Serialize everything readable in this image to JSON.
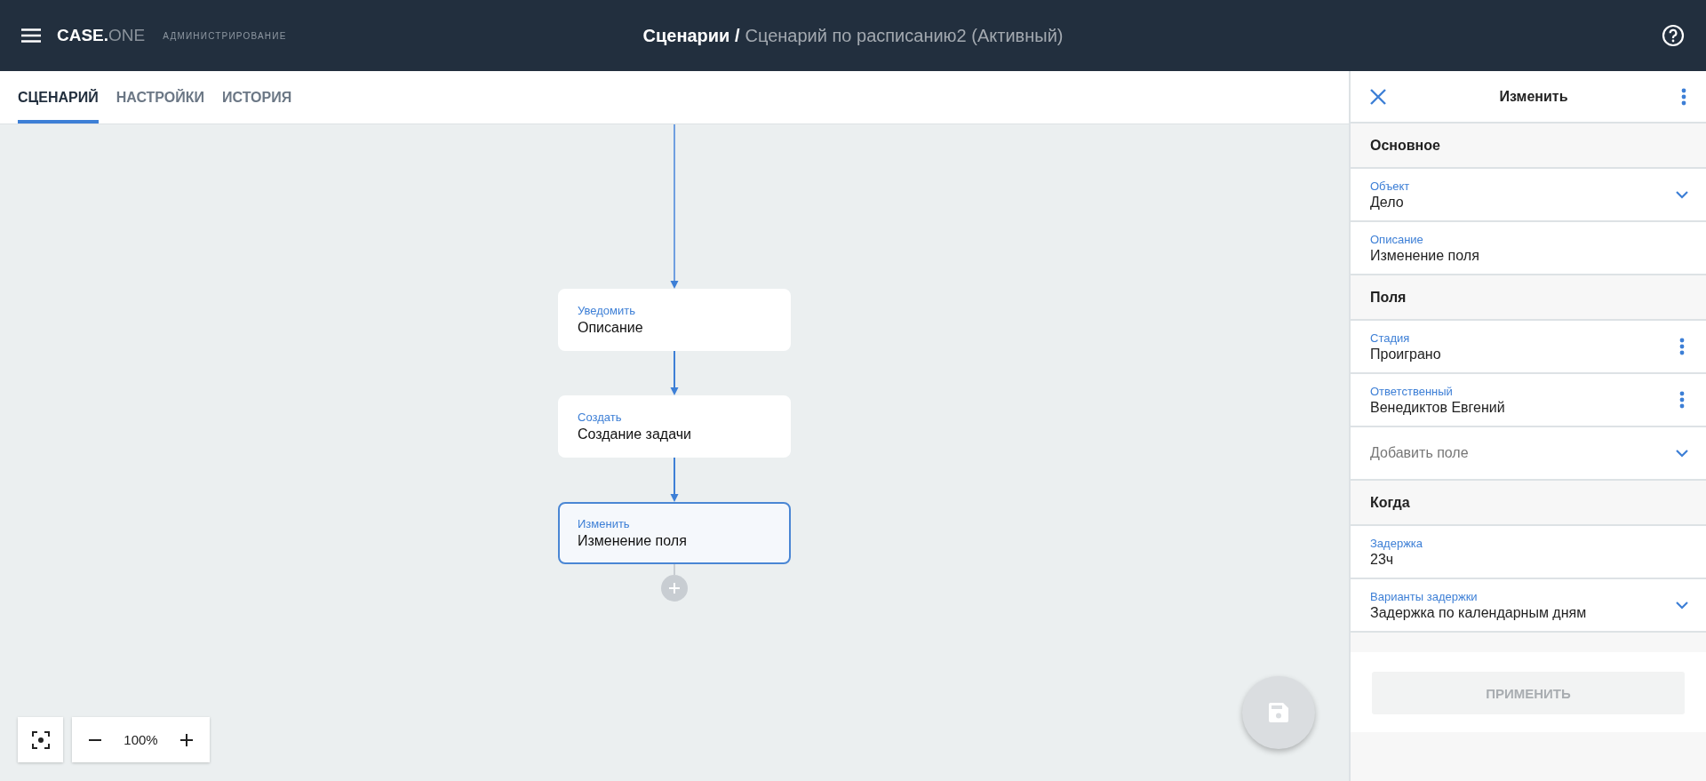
{
  "header": {
    "logo": {
      "primary": "CASE.",
      "secondary": "ONE"
    },
    "subtitle": "АДМИНИСТРИРОВАНИЕ",
    "breadcrumb": {
      "parent": "Сценарии /",
      "current": "Сценарий по расписанию2 (Активный)"
    }
  },
  "tabs": [
    {
      "label": "СЦЕНАРИЙ",
      "selected": true
    },
    {
      "label": "НАСТРОЙКИ",
      "selected": false
    },
    {
      "label": "ИСТОРИЯ",
      "selected": false
    }
  ],
  "nodes": [
    {
      "type": "Уведомить",
      "title": "Описание",
      "selected": false
    },
    {
      "type": "Создать",
      "title": "Создание задачи",
      "selected": false
    },
    {
      "type": "Изменить",
      "title": "Изменение поля",
      "selected": true
    }
  ],
  "zoom": {
    "reading": "100%"
  },
  "save": {
    "disabled": true
  },
  "panel": {
    "title": "Изменить",
    "sections": [
      {
        "heading": "Основное",
        "rows": [
          {
            "kind": "select",
            "label": "Объект",
            "value": "Дело"
          },
          {
            "kind": "text",
            "label": "Описание",
            "value": "Изменение поля"
          }
        ]
      },
      {
        "heading": "Поля",
        "rows": [
          {
            "kind": "menu",
            "label": "Стадия",
            "value": "Проиграно"
          },
          {
            "kind": "menu",
            "label": "Ответственный",
            "value": "Венедиктов Евгений"
          },
          {
            "kind": "add",
            "placeholder": "Добавить поле"
          }
        ]
      },
      {
        "heading": "Когда",
        "rows": [
          {
            "kind": "text",
            "label": "Задержка",
            "value": "23ч"
          },
          {
            "kind": "select",
            "label": "Варианты задержки",
            "value": "Задержка по календарным дням"
          }
        ]
      }
    ],
    "apply": {
      "label": "ПРИМЕНИТЬ",
      "disabled": true
    }
  }
}
